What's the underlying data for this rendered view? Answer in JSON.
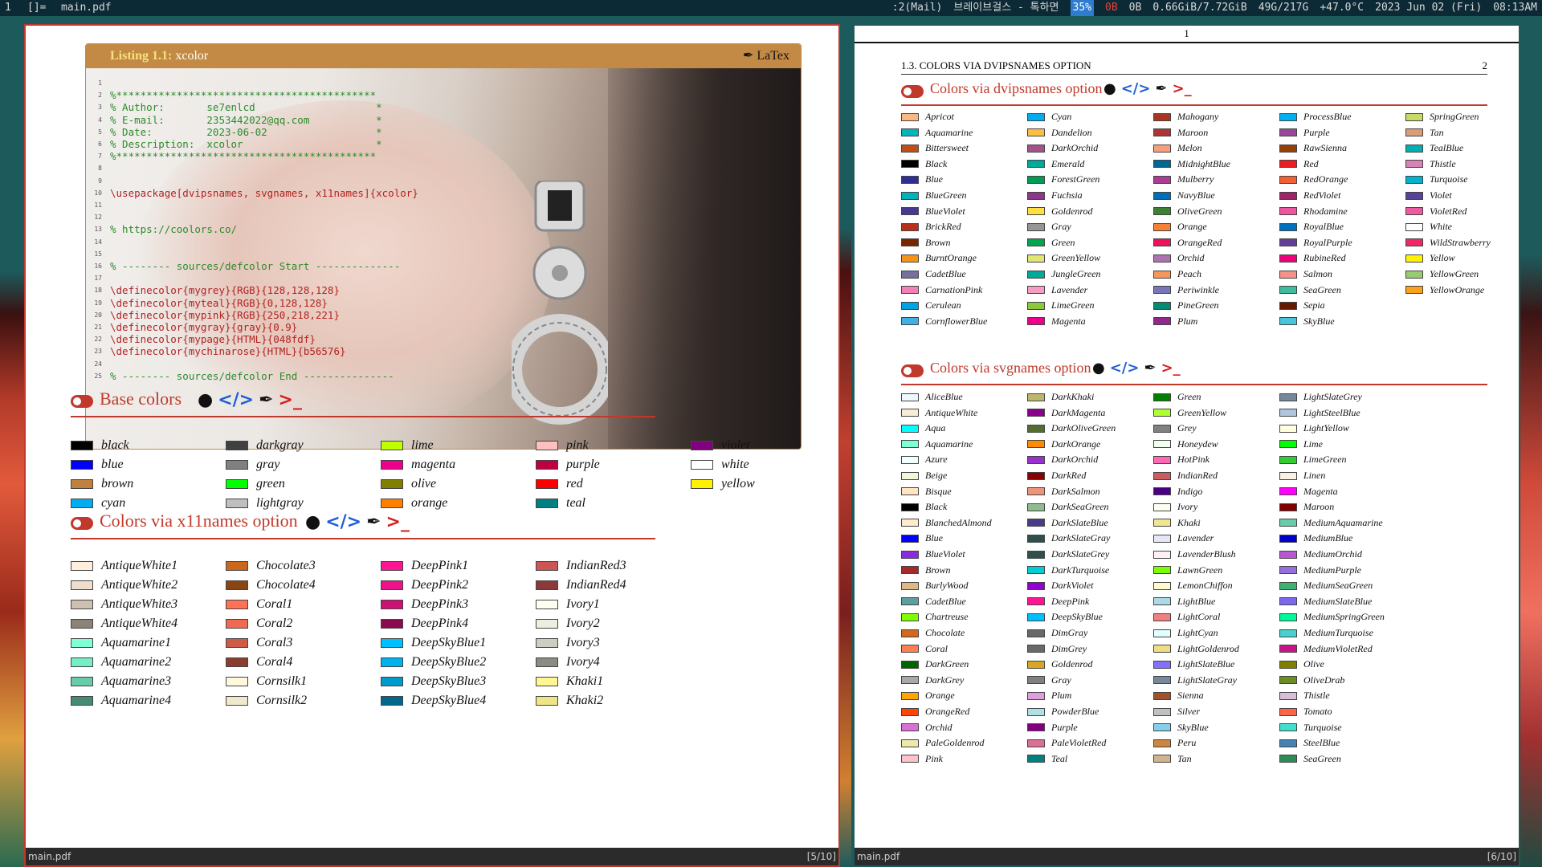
{
  "topbar": {
    "workspace": "1",
    "layout": "[]=",
    "window_title": "main.pdf",
    "indicators": [
      ":2(Mail)",
      "브레이브걸스 - 톡하면",
      "35%",
      "0B",
      "0B",
      "0.66GiB/7.72GiB",
      "49G/217G",
      "+47.0°C",
      "2023 Jun 02 (Fri)",
      "08:13AM"
    ]
  },
  "left_window": {
    "filename": "main.pdf",
    "page": "[5/10]",
    "listing": {
      "label": "Listing 1.1:",
      "name": "xcolor",
      "lang": "LaTex",
      "lines": [
        {
          "n": "1",
          "t": "",
          "c": "com"
        },
        {
          "n": "2",
          "t": "%*******************************************",
          "c": "com"
        },
        {
          "n": "3",
          "t": "% Author:       se7enlcd                    *",
          "c": "com"
        },
        {
          "n": "4",
          "t": "% E-mail:       2353442022@qq.com           *",
          "c": "com"
        },
        {
          "n": "5",
          "t": "% Date:         2023-06-02                  *",
          "c": "com"
        },
        {
          "n": "6",
          "t": "% Description:  xcolor                      *",
          "c": "com"
        },
        {
          "n": "7",
          "t": "%*******************************************",
          "c": "com"
        },
        {
          "n": "8",
          "t": "",
          "c": "com"
        },
        {
          "n": "9",
          "t": "",
          "c": "com"
        },
        {
          "n": "10",
          "t": "\\usepackage[dvipsnames, svgnames, x11names]{xcolor}",
          "c": "kw"
        },
        {
          "n": "11",
          "t": "",
          "c": "com"
        },
        {
          "n": "12",
          "t": "",
          "c": "com"
        },
        {
          "n": "13",
          "t": "% https://coolors.co/",
          "c": "com"
        },
        {
          "n": "14",
          "t": "",
          "c": "com"
        },
        {
          "n": "15",
          "t": "",
          "c": "com"
        },
        {
          "n": "16",
          "t": "% -------- sources/defcolor Start --------------",
          "c": "com"
        },
        {
          "n": "17",
          "t": "",
          "c": "com"
        },
        {
          "n": "18",
          "t": "\\definecolor{mygrey}{RGB}{128,128,128}",
          "c": "kw"
        },
        {
          "n": "19",
          "t": "\\definecolor{myteal}{RGB}{0,128,128}",
          "c": "kw"
        },
        {
          "n": "20",
          "t": "\\definecolor{mypink}{RGB}{250,218,221}",
          "c": "kw"
        },
        {
          "n": "21",
          "t": "\\definecolor{mygray}{gray}{0.9}",
          "c": "kw"
        },
        {
          "n": "22",
          "t": "\\definecolor{mypage}{HTML}{048fdf}",
          "c": "kw"
        },
        {
          "n": "23",
          "t": "\\definecolor{mychinarose}{HTML}{b56576}",
          "c": "kw"
        },
        {
          "n": "24",
          "t": "",
          "c": "com"
        },
        {
          "n": "25",
          "t": "% -------- sources/defcolor End ---------------",
          "c": "com"
        }
      ]
    },
    "base": {
      "title": "Base colors",
      "colors": [
        [
          "black",
          "#000000"
        ],
        [
          "blue",
          "#0000ff"
        ],
        [
          "brown",
          "#bf8040"
        ],
        [
          "cyan",
          "#00aeef"
        ],
        [
          "darkgray",
          "#404040"
        ],
        [
          "gray",
          "#808080"
        ],
        [
          "green",
          "#00ff00"
        ],
        [
          "lightgray",
          "#bfbfbf"
        ],
        [
          "lime",
          "#bfff00"
        ],
        [
          "magenta",
          "#ec008c"
        ],
        [
          "olive",
          "#808000"
        ],
        [
          "orange",
          "#ff8000"
        ],
        [
          "pink",
          "#ffbfbf"
        ],
        [
          "purple",
          "#bf0040"
        ],
        [
          "red",
          "#ff0000"
        ],
        [
          "teal",
          "#008080"
        ],
        [
          "violet",
          "#800080"
        ],
        [
          "white",
          "#ffffff"
        ],
        [
          "yellow",
          "#fff200"
        ]
      ]
    },
    "x11": {
      "title": "Colors via x11names option",
      "colors": [
        [
          "AntiqueWhite1",
          "#ffefdb"
        ],
        [
          "AntiqueWhite2",
          "#eedfcc"
        ],
        [
          "AntiqueWhite3",
          "#cdc0b0"
        ],
        [
          "AntiqueWhite4",
          "#8b8378"
        ],
        [
          "Aquamarine1",
          "#7fffd4"
        ],
        [
          "Aquamarine2",
          "#76eec6"
        ],
        [
          "Aquamarine3",
          "#66cdaa"
        ],
        [
          "Aquamarine4",
          "#458b74"
        ],
        [
          "Chocolate3",
          "#cd661d"
        ],
        [
          "Chocolate4",
          "#8b4513"
        ],
        [
          "Coral1",
          "#ff7256"
        ],
        [
          "Coral2",
          "#ee6a50"
        ],
        [
          "Coral3",
          "#cd5b45"
        ],
        [
          "Coral4",
          "#8b3e2f"
        ],
        [
          "Cornsilk1",
          "#fff8dc"
        ],
        [
          "Cornsilk2",
          "#eee8cd"
        ],
        [
          "DeepPink1",
          "#ff1493"
        ],
        [
          "DeepPink2",
          "#ee1289"
        ],
        [
          "DeepPink3",
          "#cd1076"
        ],
        [
          "DeepPink4",
          "#8b0a50"
        ],
        [
          "DeepSkyBlue1",
          "#00bfff"
        ],
        [
          "DeepSkyBlue2",
          "#00b2ee"
        ],
        [
          "DeepSkyBlue3",
          "#009acd"
        ],
        [
          "DeepSkyBlue4",
          "#00688b"
        ],
        [
          "IndianRed3",
          "#cd5555"
        ],
        [
          "IndianRed4",
          "#8b3a3a"
        ],
        [
          "Ivory1",
          "#fffff0"
        ],
        [
          "Ivory2",
          "#eeeee0"
        ],
        [
          "Ivory3",
          "#cdcdc1"
        ],
        [
          "Ivory4",
          "#8b8b83"
        ],
        [
          "Khaki1",
          "#fff68f"
        ],
        [
          "Khaki2",
          "#eee685"
        ]
      ]
    }
  },
  "right_window": {
    "filename": "main.pdf",
    "page": "[6/10]",
    "page_number": "1",
    "running_head": "1.3.  COLORS VIA DVIPSNAMES OPTION",
    "running_num": "2",
    "dvips": {
      "title": "Colors via dvipsnames option",
      "colors": [
        [
          "Apricot",
          "#fbb982"
        ],
        [
          "Aquamarine",
          "#00b5be"
        ],
        [
          "Bittersweet",
          "#c04f17"
        ],
        [
          "Black",
          "#000000"
        ],
        [
          "Blue",
          "#2d2f92"
        ],
        [
          "BlueGreen",
          "#00b3b8"
        ],
        [
          "BlueViolet",
          "#473992"
        ],
        [
          "BrickRed",
          "#b6321c"
        ],
        [
          "Brown",
          "#792500"
        ],
        [
          "BurntOrange",
          "#f7921d"
        ],
        [
          "CadetBlue",
          "#74729a"
        ],
        [
          "CarnationPink",
          "#f282b4"
        ],
        [
          "Cerulean",
          "#00a2e3"
        ],
        [
          "CornflowerBlue",
          "#41b0e4"
        ],
        [
          "Cyan",
          "#00aeef"
        ],
        [
          "Dandelion",
          "#fdbc42"
        ],
        [
          "DarkOrchid",
          "#a4538a"
        ],
        [
          "Emerald",
          "#00a99d"
        ],
        [
          "ForestGreen",
          "#009b55"
        ],
        [
          "Fuchsia",
          "#8c368c"
        ],
        [
          "Goldenrod",
          "#ffdf42"
        ],
        [
          "Gray",
          "#949698"
        ],
        [
          "Green",
          "#00a64f"
        ],
        [
          "GreenYellow",
          "#dfe674"
        ],
        [
          "JungleGreen",
          "#00a99a"
        ],
        [
          "Lavender",
          "#f49ec4"
        ],
        [
          "LimeGreen",
          "#8dc73e"
        ],
        [
          "Magenta",
          "#ec008c"
        ],
        [
          "Mahogany",
          "#a9341f"
        ],
        [
          "Maroon",
          "#af3235"
        ],
        [
          "Melon",
          "#f89e7b"
        ],
        [
          "MidnightBlue",
          "#006795"
        ],
        [
          "Mulberry",
          "#a93c93"
        ],
        [
          "NavyBlue",
          "#006eb8"
        ],
        [
          "OliveGreen",
          "#3c8031"
        ],
        [
          "Orange",
          "#f58137"
        ],
        [
          "OrangeRed",
          "#ed135a"
        ],
        [
          "Orchid",
          "#af72b0"
        ],
        [
          "Peach",
          "#f7965a"
        ],
        [
          "Periwinkle",
          "#7977b8"
        ],
        [
          "PineGreen",
          "#008b72"
        ],
        [
          "Plum",
          "#92268f"
        ],
        [
          "ProcessBlue",
          "#00b0f0"
        ],
        [
          "Purple",
          "#99479b"
        ],
        [
          "RawSienna",
          "#974006"
        ],
        [
          "Red",
          "#ed1b23"
        ],
        [
          "RedOrange",
          "#f26035"
        ],
        [
          "RedViolet",
          "#a1246b"
        ],
        [
          "Rhodamine",
          "#ef559f"
        ],
        [
          "RoyalBlue",
          "#0071bc"
        ],
        [
          "RoyalPurple",
          "#613f99"
        ],
        [
          "RubineRed",
          "#ed017d"
        ],
        [
          "Salmon",
          "#f69289"
        ],
        [
          "SeaGreen",
          "#3fbc9d"
        ],
        [
          "Sepia",
          "#671800"
        ],
        [
          "SkyBlue",
          "#46c5dd"
        ],
        [
          "SpringGreen",
          "#c6dc67"
        ],
        [
          "Tan",
          "#da9d76"
        ],
        [
          "TealBlue",
          "#00aeb3"
        ],
        [
          "Thistle",
          "#d883b7"
        ],
        [
          "Turquoise",
          "#00b4ce"
        ],
        [
          "Violet",
          "#58429b"
        ],
        [
          "VioletRed",
          "#ef58a0"
        ],
        [
          "White",
          "#ffffff"
        ],
        [
          "WildStrawberry",
          "#ee2967"
        ],
        [
          "Yellow",
          "#fff200"
        ],
        [
          "YellowGreen",
          "#98cc70"
        ],
        [
          "YellowOrange",
          "#faa21a"
        ]
      ]
    },
    "svg": {
      "title": "Colors via svgnames option",
      "colors": [
        [
          "AliceBlue",
          "#f0f8ff"
        ],
        [
          "AntiqueWhite",
          "#faebd7"
        ],
        [
          "Aqua",
          "#00ffff"
        ],
        [
          "Aquamarine",
          "#7fffd4"
        ],
        [
          "Azure",
          "#f0ffff"
        ],
        [
          "Beige",
          "#f5f5dc"
        ],
        [
          "Bisque",
          "#ffe4c4"
        ],
        [
          "Black",
          "#000000"
        ],
        [
          "BlanchedAlmond",
          "#ffebcd"
        ],
        [
          "Blue",
          "#0000ff"
        ],
        [
          "BlueViolet",
          "#8a2be2"
        ],
        [
          "Brown",
          "#a52a2a"
        ],
        [
          "BurlyWood",
          "#deb887"
        ],
        [
          "CadetBlue",
          "#5f9ea0"
        ],
        [
          "Chartreuse",
          "#7fff00"
        ],
        [
          "Chocolate",
          "#d2691e"
        ],
        [
          "Coral",
          "#ff7f50"
        ],
        [
          "DarkGreen",
          "#006400"
        ],
        [
          "DarkGrey",
          "#a9a9a9"
        ],
        [
          "Orange",
          "#ffa500"
        ],
        [
          "OrangeRed",
          "#ff4500"
        ],
        [
          "Orchid",
          "#da70d6"
        ],
        [
          "PaleGoldenrod",
          "#eee8aa"
        ],
        [
          "Pink",
          "#ffc0cb"
        ],
        [
          "DarkKhaki",
          "#bdb76b"
        ],
        [
          "DarkMagenta",
          "#8b008b"
        ],
        [
          "DarkOliveGreen",
          "#556b2f"
        ],
        [
          "DarkOrange",
          "#ff8c00"
        ],
        [
          "DarkOrchid",
          "#9932cc"
        ],
        [
          "DarkRed",
          "#8b0000"
        ],
        [
          "DarkSalmon",
          "#e9967a"
        ],
        [
          "DarkSeaGreen",
          "#8fbc8f"
        ],
        [
          "DarkSlateBlue",
          "#483d8b"
        ],
        [
          "DarkSlateGray",
          "#2f4f4f"
        ],
        [
          "DarkSlateGrey",
          "#2f4f4f"
        ],
        [
          "DarkTurquoise",
          "#00ced1"
        ],
        [
          "DarkViolet",
          "#9400d3"
        ],
        [
          "DeepPink",
          "#ff1493"
        ],
        [
          "DeepSkyBlue",
          "#00bfff"
        ],
        [
          "DimGray",
          "#696969"
        ],
        [
          "DimGrey",
          "#696969"
        ],
        [
          "Goldenrod",
          "#daa520"
        ],
        [
          "Gray",
          "#808080"
        ],
        [
          "Plum",
          "#dda0dd"
        ],
        [
          "PowderBlue",
          "#b0e0e6"
        ],
        [
          "Purple",
          "#800080"
        ],
        [
          "PaleVioletRed",
          "#db7093"
        ],
        [
          "Teal",
          "#008080"
        ],
        [
          "Green",
          "#008000"
        ],
        [
          "GreenYellow",
          "#adff2f"
        ],
        [
          "Grey",
          "#808080"
        ],
        [
          "Honeydew",
          "#f0fff0"
        ],
        [
          "HotPink",
          "#ff69b4"
        ],
        [
          "IndianRed",
          "#cd5c5c"
        ],
        [
          "Indigo",
          "#4b0082"
        ],
        [
          "Ivory",
          "#fffff0"
        ],
        [
          "Khaki",
          "#f0e68c"
        ],
        [
          "Lavender",
          "#e6e6fa"
        ],
        [
          "LavenderBlush",
          "#fff0f5"
        ],
        [
          "LawnGreen",
          "#7cfc00"
        ],
        [
          "LemonChiffon",
          "#fffacd"
        ],
        [
          "LightBlue",
          "#add8e6"
        ],
        [
          "LightCoral",
          "#f08080"
        ],
        [
          "LightCyan",
          "#e0ffff"
        ],
        [
          "LightGoldenrod",
          "#eedd82"
        ],
        [
          "LightSlateBlue",
          "#8470ff"
        ],
        [
          "LightSlateGray",
          "#778899"
        ],
        [
          "Sienna",
          "#a0522d"
        ],
        [
          "Silver",
          "#c0c0c0"
        ],
        [
          "SkyBlue",
          "#87ceeb"
        ],
        [
          "Peru",
          "#cd853f"
        ],
        [
          "Tan",
          "#d2b48c"
        ],
        [
          "LightSlateGrey",
          "#778899"
        ],
        [
          "LightSteelBlue",
          "#b0c4de"
        ],
        [
          "LightYellow",
          "#ffffe0"
        ],
        [
          "Lime",
          "#00ff00"
        ],
        [
          "LimeGreen",
          "#32cd32"
        ],
        [
          "Linen",
          "#faf0e6"
        ],
        [
          "Magenta",
          "#ff00ff"
        ],
        [
          "Maroon",
          "#800000"
        ],
        [
          "MediumAquamarine",
          "#66cdaa"
        ],
        [
          "MediumBlue",
          "#0000cd"
        ],
        [
          "MediumOrchid",
          "#ba55d3"
        ],
        [
          "MediumPurple",
          "#9370db"
        ],
        [
          "MediumSeaGreen",
          "#3cb371"
        ],
        [
          "MediumSlateBlue",
          "#7b68ee"
        ],
        [
          "MediumSpringGreen",
          "#00fa9a"
        ],
        [
          "MediumTurquoise",
          "#48d1cc"
        ],
        [
          "MediumVioletRed",
          "#c71585"
        ],
        [
          "Olive",
          "#808000"
        ],
        [
          "OliveDrab",
          "#6b8e23"
        ],
        [
          "Thistle",
          "#d8bfd8"
        ],
        [
          "Tomato",
          "#ff6347"
        ],
        [
          "Turquoise",
          "#40e0d0"
        ],
        [
          "SteelBlue",
          "#4682b4"
        ],
        [
          "SeaGreen",
          "#2e8b57"
        ]
      ]
    }
  }
}
